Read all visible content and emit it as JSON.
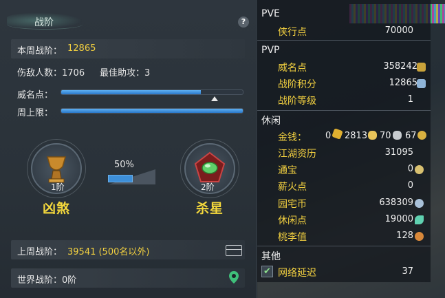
{
  "left_panel": {
    "title": "战阶",
    "help": "?",
    "this_week_label": "本周战阶：",
    "this_week_value": "12865",
    "enemies_label": "伤敌人数：1706",
    "assist_label": "最佳助攻：3",
    "prestige_label": "威名点：",
    "prestige_fill": 0.77,
    "weekly_cap_label": "周上限：",
    "weekly_cap_fill": 1.0,
    "current_rank": {
      "tier": "1阶",
      "name": "凶煞"
    },
    "progress_percent": "50%",
    "progress_fill": 0.5,
    "next_rank": {
      "tier": "2阶",
      "name": "杀星"
    },
    "last_week_label": "上周战阶：",
    "last_week_value": "39541 (500名以外)",
    "world_label": "世界战阶：0阶"
  },
  "right_panel": {
    "sections": {
      "pve": "PVE",
      "pvp": "PVP",
      "leisure": "休闲",
      "other": "其他"
    },
    "pve_items": [
      {
        "name": "侠行点",
        "value": "70000"
      }
    ],
    "pvp_items": [
      {
        "name": "威名点",
        "value": "358242"
      },
      {
        "name": "战阶积分",
        "value": "12865"
      },
      {
        "name": "战阶等级",
        "value": "1"
      }
    ],
    "gold": {
      "name": "金钱：",
      "v1": "0",
      "v2": "2813",
      "v3": "70",
      "v4": "67"
    },
    "leisure_items": [
      {
        "name": "江湖资历",
        "value": "31095"
      },
      {
        "name": "通宝",
        "value": "0"
      },
      {
        "name": "薪火点",
        "value": "0"
      },
      {
        "name": "园宅币",
        "value": "638309"
      },
      {
        "name": "休闲点",
        "value": "19000"
      },
      {
        "name": "桃李值",
        "value": "128"
      }
    ],
    "other_items": [
      {
        "name": "网络延迟",
        "value": "37"
      }
    ],
    "colors": {
      "name": "#f2d040",
      "value": "#f0f0f0"
    }
  }
}
